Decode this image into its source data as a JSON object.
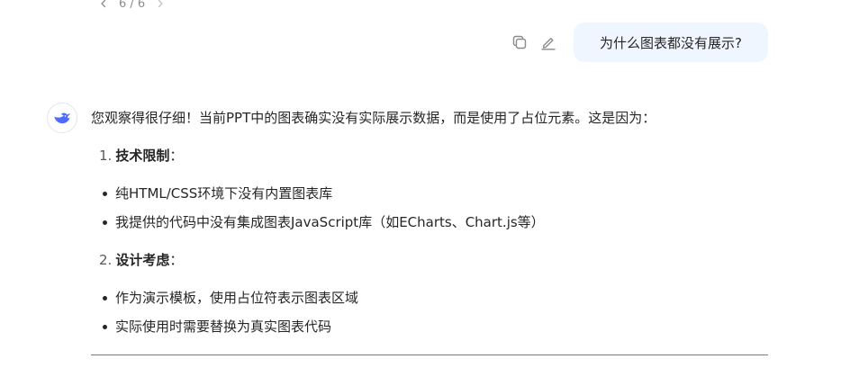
{
  "pager": {
    "text": "6 / 6"
  },
  "user_message": {
    "text": "为什么图表都没有展示?"
  },
  "assistant": {
    "intro": "您观察得很仔细！当前PPT中的图表确实没有实际展示数据，而是使用了占位元素。这是因为：",
    "sections": [
      {
        "num": "1.",
        "title": "技术限制",
        "colon": "：",
        "bullets": [
          "纯HTML/CSS环境下没有内置图表库",
          "我提供的代码中没有集成图表JavaScript库（如ECharts、Chart.js等）"
        ]
      },
      {
        "num": "2.",
        "title": "设计考虑",
        "colon": "：",
        "bullets": [
          "作为演示模板，使用占位符表示图表区域",
          "实际使用时需要替换为真实图表代码"
        ]
      }
    ]
  },
  "colors": {
    "bubble": "#eff6ff",
    "logo": "#4d6bfe"
  }
}
